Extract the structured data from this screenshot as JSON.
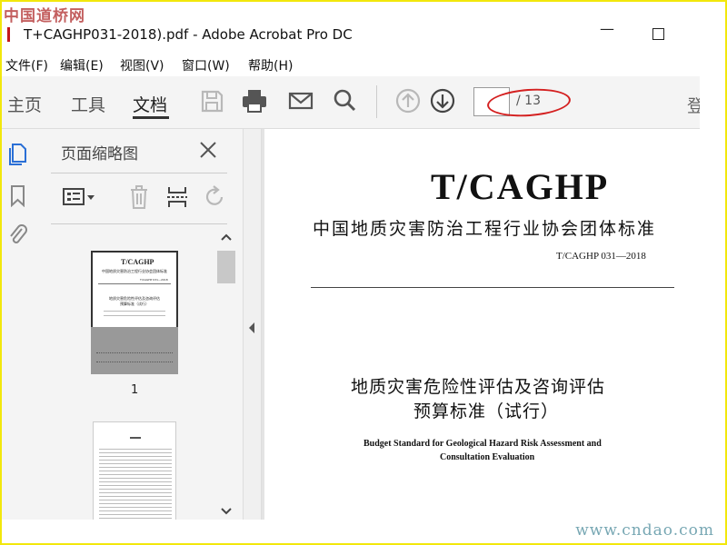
{
  "watermark": {
    "top": "中国道桥网",
    "bottom": "www.cndao.com"
  },
  "window": {
    "title": "T+CAGHP031-2018).pdf - Adobe Acrobat Pro DC",
    "minimize": "—"
  },
  "menu": [
    "文件(F)",
    "编辑(E)",
    "视图(V)",
    "窗口(W)",
    "帮助(H)"
  ],
  "tabs": {
    "home": "主页",
    "tools": "工具",
    "document": "文档"
  },
  "pager": {
    "current": "",
    "total": "/ 13"
  },
  "login": "登",
  "panel": {
    "title": "页面缩略图",
    "thumb1_num": "1"
  },
  "thumb1": {
    "brand": "T/CAGHP",
    "org": "中国地质灾害防治工程行业协会团体标准",
    "code": "T/CAGHP 031—2018",
    "t1": "地质灾害危险性评估及咨询评估",
    "t2": "预算标准（试行）"
  },
  "document": {
    "brand": "T/CAGHP",
    "org": "中国地质灾害防治工程行业协会团体标准",
    "code": "T/CAGHP 031—2018",
    "title_line1": "地质灾害危险性评估及咨询评估",
    "title_line2": "预算标准（试行）",
    "en_line1": "Budget Standard for Geological Hazard Risk Assessment and",
    "en_line2": "Consultation Evaluation"
  },
  "colors": {
    "accent": "#2a6fd6",
    "annotation": "#d42020",
    "watermark": "#b02a2a"
  },
  "icons": [
    "save-icon",
    "print-icon",
    "email-icon",
    "search-icon",
    "page-up-icon",
    "page-down-icon",
    "thumbnails-icon",
    "bookmark-icon",
    "attachment-icon",
    "close-icon",
    "options-icon",
    "delete-icon",
    "insert-icon",
    "rotate-icon"
  ]
}
